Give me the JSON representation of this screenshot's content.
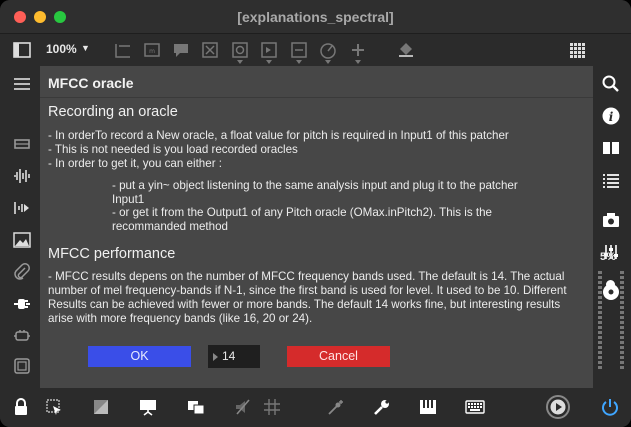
{
  "window": {
    "title": "[explanations_spectral]"
  },
  "toolbar": {
    "zoom": "100%",
    "zoom_caret": "▼"
  },
  "panel": {
    "title": "MFCC oracle",
    "section1_heading": "Recording an oracle",
    "section1_lines": [
      "- In orderTo record a New oracle, a float value for pitch is required in Input1 of this patcher",
      "- This is not needed is you load recorded oracles",
      "- In order to get it, you can either :"
    ],
    "section1_options": [
      "- put a yin~ object listening to the same analysis input and plug it to the patcher Input1",
      "- or get it from the Output1 of any Pitch oracle (OMax.inPitch2). This is the recommanded method"
    ],
    "section2_heading": "MFCC performance",
    "section2_text": "- MFCC results depens on the number of MFCC frequency bands used. The default is 14. The actual number of mel frequency-bands if N-1, since the first band is used for level. It used to be 10. Different Results can be achieved with fewer or more bands. The default 14 works fine, but interesting results arise with more frequency bands (like 16, 20 or 24).",
    "ok_label": "OK",
    "bands_value": "14",
    "cancel_label": "Cancel",
    "colors": {
      "ok": "#3a4ee8",
      "cancel": "#d52b2b",
      "panel": "#474747"
    }
  },
  "rightbar": {
    "percent": "5%",
    "level": 0.05
  }
}
